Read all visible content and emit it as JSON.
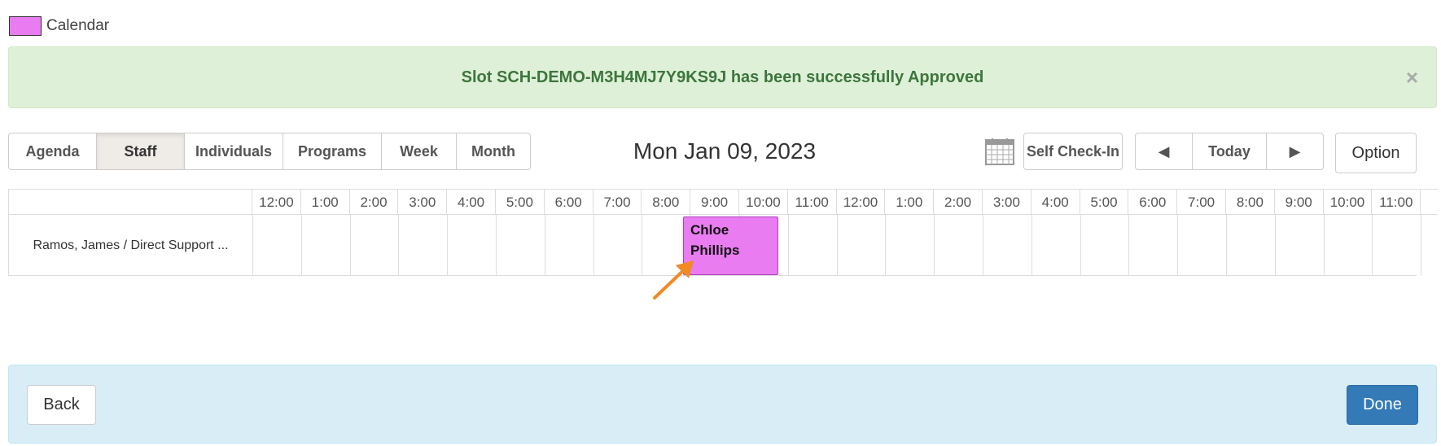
{
  "legend": {
    "label": "Calendar",
    "color": "#e87cf0"
  },
  "alert": {
    "message": "Slot SCH-DEMO-M3H4MJ7Y9KS9J has been successfully Approved",
    "close": "×"
  },
  "views": [
    "Agenda",
    "Staff",
    "Individuals",
    "Programs",
    "Week",
    "Month"
  ],
  "active_view": "Staff",
  "date_title": "Mon Jan 09, 2023",
  "toolbar": {
    "calendar_icon": "calendar-grid-icon",
    "self_checkin": "Self Check-In",
    "prev": "◀",
    "today": "Today",
    "next": "▶",
    "option": "Option"
  },
  "grid": {
    "hours": [
      "12:00",
      "1:00",
      "2:00",
      "3:00",
      "4:00",
      "5:00",
      "6:00",
      "7:00",
      "8:00",
      "9:00",
      "10:00",
      "11:00",
      "12:00",
      "1:00",
      "2:00",
      "3:00",
      "4:00",
      "5:00",
      "6:00",
      "7:00",
      "8:00",
      "9:00",
      "10:00",
      "11:00"
    ],
    "rows": [
      {
        "label": "Ramos, James / Direct Support ..."
      }
    ],
    "events": [
      {
        "title_line1": "Chloe",
        "title_line2": "Phillips",
        "color": "#e87cf0"
      }
    ]
  },
  "footer": {
    "back": "Back",
    "done": "Done"
  },
  "colors": {
    "alert_bg": "#dff0d8",
    "alert_text": "#3c763d",
    "footer_bg": "#d9edf7",
    "primary": "#337ab7",
    "arrow": "#f08a24"
  }
}
